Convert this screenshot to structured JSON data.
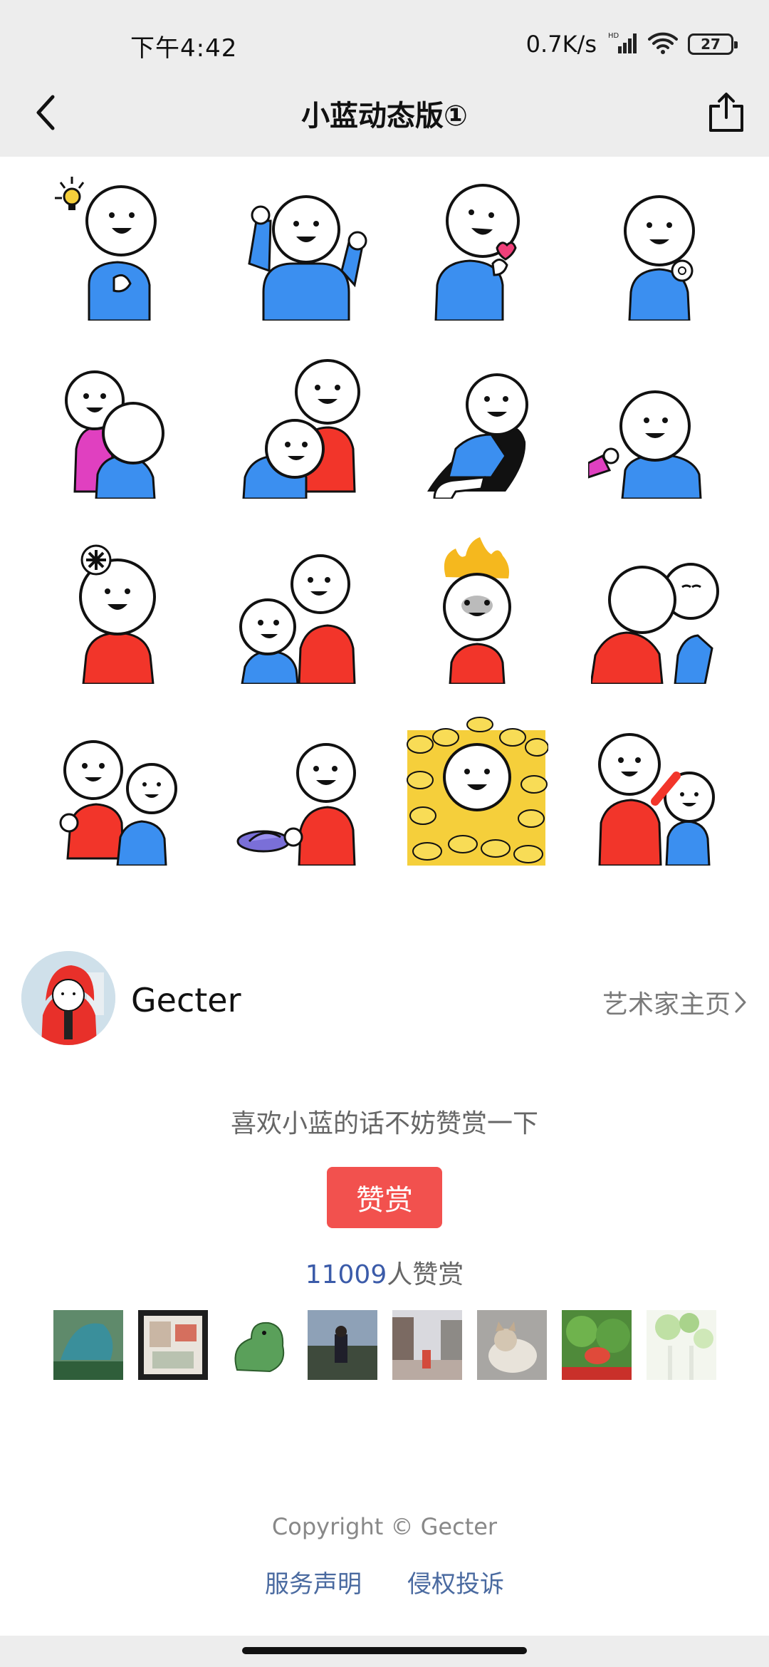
{
  "status_bar": {
    "time": "下午4:42",
    "network_speed": "0.7K/s",
    "network_type": "HD",
    "battery_level": "27",
    "icons": [
      "signal-icon",
      "wifi-icon",
      "battery-icon"
    ]
  },
  "nav": {
    "title": "小蓝动态版①",
    "back_icon": "chevron-left-icon",
    "share_icon": "share-icon"
  },
  "stickers": {
    "count": 16,
    "columns": 4,
    "colors": {
      "blue": "#3b8ff0",
      "red": "#f2352a",
      "pink": "#e040c0",
      "yellow": "#f5cf3b"
    }
  },
  "artist": {
    "name": "Gecter",
    "homepage_link": "艺术家主页"
  },
  "reward": {
    "prompt": "喜欢小蓝的话不妨赞赏一下",
    "button_label": "赞赏",
    "count": "11009",
    "count_suffix": "人赞赏",
    "supporter_count": 8
  },
  "footer": {
    "copyright": "Copyright © Gecter",
    "links": [
      "服务声明",
      "侵权投诉"
    ]
  },
  "colors": {
    "header_bg": "#ededed",
    "reward_button": "#f2514e",
    "link_blue": "#4a6aa0",
    "count_blue": "#3b5ba9"
  }
}
